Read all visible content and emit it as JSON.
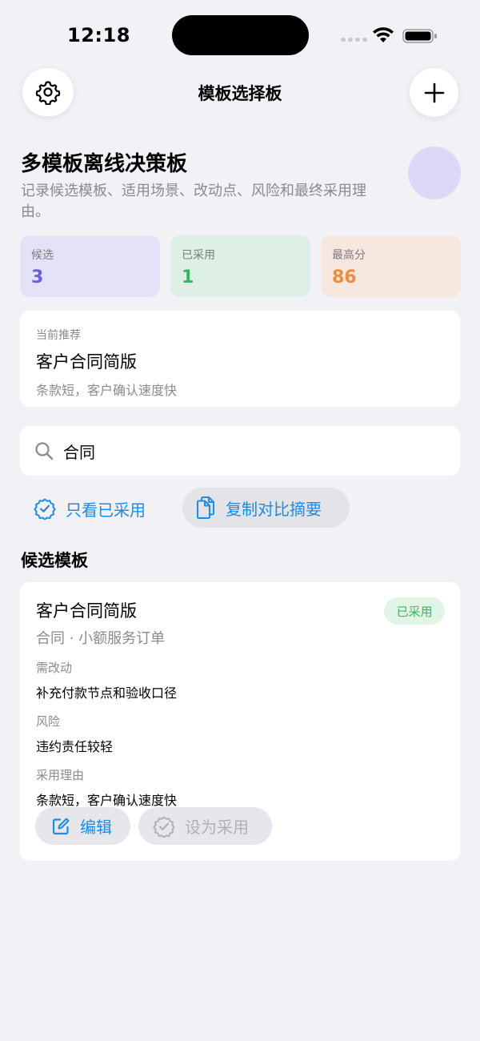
{
  "status": {
    "time": "12:18"
  },
  "nav": {
    "title": "模板选择板"
  },
  "header": {
    "title": "多模板离线决策板",
    "description": "记录候选模板、适用场景、改动点、风险和最终采用理由。"
  },
  "stats": [
    {
      "label": "候选",
      "value": "3"
    },
    {
      "label": "已采用",
      "value": "1"
    },
    {
      "label": "最高分",
      "value": "86"
    }
  ],
  "recommendation": {
    "label": "当前推荐",
    "name": "客户合同简版",
    "desc": "条款短，客户确认速度快"
  },
  "search": {
    "value": "合同"
  },
  "filters": {
    "adopted_only": "只看已采用",
    "copy_summary": "复制对比摘要"
  },
  "section": {
    "title": "候选模板"
  },
  "templates": [
    {
      "name": "客户合同简版",
      "meta": "合同 · 小额服务订单",
      "badge": "已采用",
      "changes_label": "需改动",
      "changes": "补充付款节点和验收口径",
      "risk_label": "风险",
      "risk": "违约责任较轻",
      "reason_label": "采用理由",
      "reason": "条款短，客户确认速度快",
      "edit_label": "编辑",
      "adopt_label": "设为采用"
    }
  ],
  "colors": {
    "accent": "#1a8cf0",
    "candidate": "#6a5ee0",
    "adopted": "#3bb55a",
    "top_score": "#ef8b3a"
  }
}
